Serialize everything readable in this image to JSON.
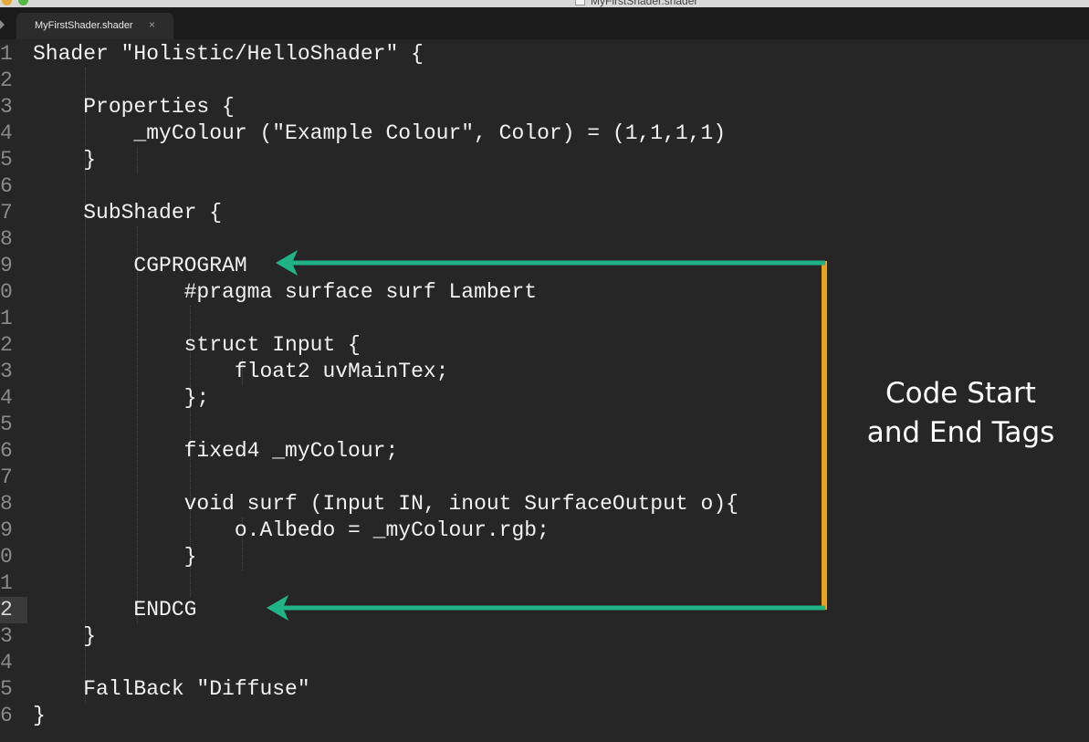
{
  "window": {
    "title": "MyFirstShader.shader"
  },
  "tabs": [
    {
      "label": "MyFirstShader.shader",
      "close": "×"
    }
  ],
  "editor": {
    "current_line": 22,
    "line_numbers": [
      "1",
      "2",
      "3",
      "4",
      "5",
      "6",
      "7",
      "8",
      "9",
      "0",
      "1",
      "2",
      "3",
      "4",
      "5",
      "6",
      "7",
      "8",
      "9",
      "0",
      "1",
      "2",
      "3",
      "4",
      "5",
      "6"
    ],
    "lines": [
      "Shader \"Holistic/HelloShader\" {",
      "",
      "    Properties {",
      "        _myColour (\"Example Colour\", Color) = (1,1,1,1)",
      "    }",
      "",
      "    SubShader {",
      "",
      "        CGPROGRAM",
      "            #pragma surface surf Lambert",
      "",
      "            struct Input {",
      "                float2 uvMainTex;",
      "            };",
      "",
      "            fixed4 _myColour;",
      "",
      "            void surf (Input IN, inout SurfaceOutput o){",
      "                o.Albedo = _myColour.rgb;",
      "            }",
      "",
      "        ENDCG",
      "    }",
      "",
      "    FallBack \"Diffuse\"",
      "}"
    ]
  },
  "annotation": {
    "line1": "Code Start",
    "line2": "and End Tags",
    "arrow_color": "#1fb386",
    "bracket_color": "#e9a21e"
  }
}
